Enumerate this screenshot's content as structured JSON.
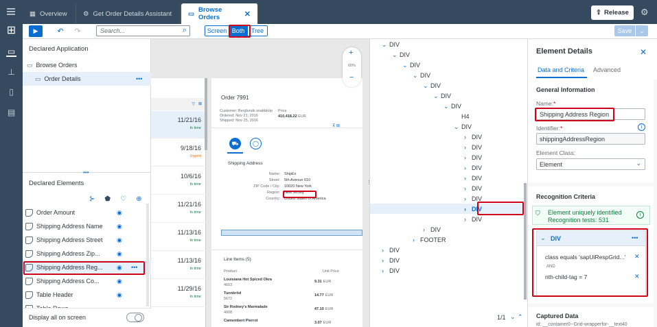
{
  "topbar": {
    "tabs": [
      {
        "label": "Overview"
      },
      {
        "label": "Get Order Details Assistant"
      },
      {
        "label": "Browse Orders"
      }
    ],
    "release_label": "Release"
  },
  "toolbar": {
    "search_placeholder": "Search...",
    "view_modes": [
      "Screen",
      "Both",
      "Tree"
    ],
    "save_label": "Save"
  },
  "declared_application": {
    "title": "Declared Application",
    "items": [
      {
        "label": "Browse Orders"
      },
      {
        "label": "Order Details"
      }
    ]
  },
  "declared_elements": {
    "title": "Declared Elements",
    "items": [
      {
        "label": "Order Amount"
      },
      {
        "label": "Shipping Address Name"
      },
      {
        "label": "Shipping Address Street"
      },
      {
        "label": "Shipping Address Zip..."
      },
      {
        "label": "Shipping Address Reg..."
      },
      {
        "label": "Shipping Address Co..."
      },
      {
        "label": "Table Header"
      },
      {
        "label": "Table Rows"
      }
    ],
    "display_all_label": "Display all on screen"
  },
  "preview": {
    "zoom": "60%",
    "list_rows": [
      {
        "date": "11/21/16",
        "status": "In time"
      },
      {
        "date": "9/18/16",
        "status": "Urgent"
      },
      {
        "date": "10/6/16",
        "status": "In time"
      },
      {
        "date": "11/21/16",
        "status": "In time"
      },
      {
        "date": "11/13/16",
        "status": "In time"
      },
      {
        "date": "11/13/16",
        "status": "In time"
      },
      {
        "date": "11/29/16",
        "status": "In time"
      }
    ],
    "order": {
      "title": "Order 7991",
      "customer": "Customer: Berglunds snabbköp",
      "ordered": "Ordered: Nov 21, 2016",
      "shipped": "Shipped: Nov 25, 2016",
      "price_label": "Price",
      "price_value": "410,418.22",
      "price_currency": "EUR",
      "shipping_title": "Shipping Address",
      "fields": [
        {
          "label": "Name:",
          "value": "ShipEx"
        },
        {
          "label": "Street:",
          "value": "5th Avenue 610"
        },
        {
          "label": "ZIP Code / City:",
          "value": "10020 New York"
        },
        {
          "label": "Region:",
          "value": "New Jersey"
        },
        {
          "label": "Country:",
          "value": "United States of America"
        }
      ],
      "line_items_title": "Line Items (5)",
      "col_product": "Product",
      "col_price": "Unit Price",
      "line_items": [
        {
          "name": "Louisiana Hot Spiced Okra",
          "id": "4663",
          "price": "9.31",
          "cur": "EUR"
        },
        {
          "name": "Tunnbröd",
          "id": "5672",
          "price": "14.77",
          "cur": "EUR"
        },
        {
          "name": "Sir Rodney's Marmalade",
          "id": "4008",
          "price": "47.10",
          "cur": "EUR"
        },
        {
          "name": "Camembert Pierrot",
          "id": "",
          "price": "3.07",
          "cur": "EUR"
        }
      ]
    }
  },
  "tree": {
    "nodes": [
      {
        "label": "DIV",
        "depth": 0,
        "arrow": "down"
      },
      {
        "label": "DIV",
        "depth": 1,
        "arrow": "down"
      },
      {
        "label": "DIV",
        "depth": 2,
        "arrow": "down"
      },
      {
        "label": "DIV",
        "depth": 3,
        "arrow": "down"
      },
      {
        "label": "DIV",
        "depth": 4,
        "arrow": "down"
      },
      {
        "label": "DIV",
        "depth": 5,
        "arrow": "down"
      },
      {
        "label": "DIV",
        "depth": 6,
        "arrow": "down"
      },
      {
        "label": "H4",
        "depth": 7,
        "arrow": "none"
      },
      {
        "label": "DIV",
        "depth": 7,
        "arrow": "down"
      },
      {
        "label": "DIV",
        "depth": 8,
        "arrow": "right"
      },
      {
        "label": "DIV",
        "depth": 8,
        "arrow": "right"
      },
      {
        "label": "DIV",
        "depth": 8,
        "arrow": "right"
      },
      {
        "label": "DIV",
        "depth": 8,
        "arrow": "right"
      },
      {
        "label": "DIV",
        "depth": 8,
        "arrow": "right"
      },
      {
        "label": "DIV",
        "depth": 8,
        "arrow": "right"
      },
      {
        "label": "DIV",
        "depth": 8,
        "arrow": "right"
      },
      {
        "label": "DIV",
        "depth": 8,
        "arrow": "right"
      },
      {
        "label": "DIV",
        "depth": 8,
        "arrow": "right"
      },
      {
        "label": "DIV",
        "depth": 4,
        "arrow": "right"
      },
      {
        "label": "FOOTER",
        "depth": 3,
        "arrow": "right"
      },
      {
        "label": "DIV",
        "depth": 0,
        "arrow": "right"
      },
      {
        "label": "DIV",
        "depth": 0,
        "arrow": "right"
      },
      {
        "label": "DIV",
        "depth": 0,
        "arrow": "right"
      }
    ],
    "pager": "1/1"
  },
  "details": {
    "title": "Element Details",
    "tabs": [
      "Data and Criteria",
      "Advanced"
    ],
    "general_info": "General Information",
    "name_label": "Name:",
    "name_value": "Shipping Address Region",
    "identifier_label": "Identifier:",
    "identifier_value": "shippingAddressRegion",
    "class_label": "Element Class:",
    "class_value": "Element",
    "recognition_title": "Recognition Criteria",
    "recognition_msg1": "Element uniquely identified",
    "recognition_msg2": "Recognition tests: 531",
    "criteria_node": "DIV",
    "criterion1": "class equals 'sapUiRespGrid...'",
    "and_label": "AND",
    "criterion2": "nth-child-tag = 7",
    "captured_title": "Captured Data",
    "captured_id": "id: __container0--Grid-wrapperfor-__text40"
  },
  "colors": {
    "shell": "#354a5f",
    "accent": "#0a6ed1",
    "success": "#107e3e",
    "highlight": "#d0021b"
  }
}
